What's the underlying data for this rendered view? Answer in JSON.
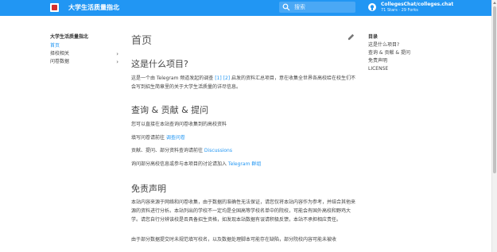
{
  "header": {
    "site_title": "大学生活质量指北",
    "search_placeholder": "搜索",
    "repo_name": "CollegesChat/colleges.chat",
    "repo_stats": "71 Stars · 29 Forks"
  },
  "nav": {
    "title": "大学生活质量指北",
    "items": [
      {
        "label": "首页",
        "active": true
      },
      {
        "label": "择校相关",
        "expandable": true
      },
      {
        "label": "问卷数据",
        "expandable": true
      }
    ]
  },
  "main": {
    "page_title": "首页",
    "sections": [
      {
        "heading": "这是什么项目?",
        "paragraph": {
          "before": "这是一个由 Telegram 频道发起的调查 ",
          "link1": "[1]",
          "middle": " ",
          "link2": "[2]",
          "after": " 启发的资料汇总项目，意在收集全世界各高校给在校生们不会写到招生简章里的关于大学生活质量的详尽信息。"
        }
      },
      {
        "heading": "查询 & 贡献 & 提问",
        "lines": [
          {
            "text": "您可以直接在本站查询问卷收集到的高校资料",
            "link": ""
          },
          {
            "text": "填写问卷请前往 ",
            "link": "调查问卷"
          },
          {
            "text": "贡献、提问、部分资料查询请前往 ",
            "link": "Discussions"
          },
          {
            "text": "询问部分高校信息或参与本项目的讨论请加入 ",
            "link": "Telegram 群组"
          }
        ]
      },
      {
        "heading": "免责声明",
        "paragraphs": [
          "本站内容来源于网络和问卷收集，由于数据的准确性无法保证，请您仅将本站内容作为参考，并结合其他来源的资料进行分析。本站列出的学校不一定均是全国高等学校名单中的院校，可能会有国外高校和野鸡大学。请您自行分辨该校是否具备招生资格，如发现本站数据有误请积极反馈，本站不承担相应责任。",
          "由于部分数据提交时未规范填写校名，以及数据处理脚本可能存在缺陷，部分院校内容可能未被收"
        ]
      }
    ]
  },
  "toc": {
    "title": "目录",
    "items": [
      "这是什么项目?",
      "查询 & 贡献 & 提问",
      "免责声明",
      "LICENSE"
    ]
  },
  "colors": {
    "primary": "#2196f3",
    "link": "#2196f3"
  }
}
